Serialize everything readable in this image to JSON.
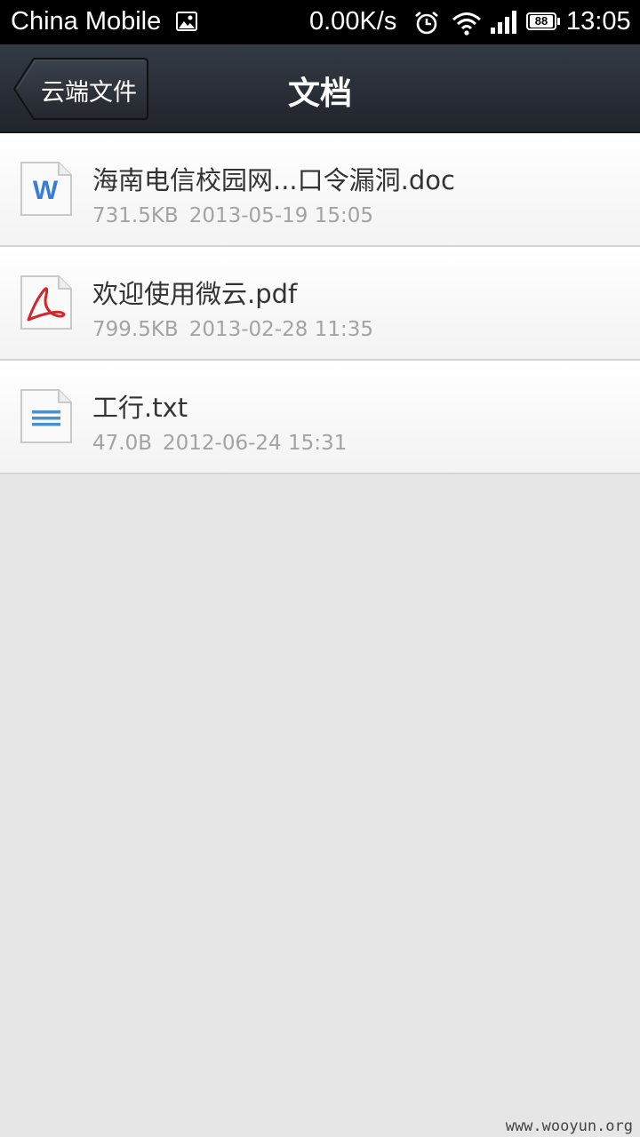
{
  "status_bar": {
    "carrier": "China Mobile",
    "net_speed": "0.00K/s",
    "battery": "88",
    "time": "13:05"
  },
  "nav": {
    "back_label": "云端文件",
    "title": "文档"
  },
  "files": [
    {
      "name": "海南电信校园网...口令漏洞.doc",
      "size": "731.5KB",
      "date": "2013-05-19 15:05",
      "icon": "word-doc-icon"
    },
    {
      "name": "欢迎使用微云.pdf",
      "size": "799.5KB",
      "date": "2013-02-28 11:35",
      "icon": "pdf-icon"
    },
    {
      "name": "工行.txt",
      "size": "47.0B",
      "date": "2012-06-24 15:31",
      "icon": "text-file-icon"
    }
  ],
  "watermark": "www.wooyun.org",
  "colors": {
    "title_bar": "#2b3038",
    "background": "#e6e6e6",
    "word_blue": "#3a7bd5",
    "pdf_red": "#d0262b",
    "txt_blue": "#4a8fd0"
  }
}
